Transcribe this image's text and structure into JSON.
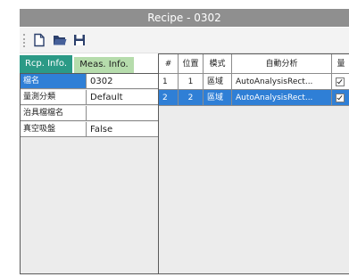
{
  "window": {
    "title": "Recipe - 0302"
  },
  "toolbar": {
    "new_icon": "new-file-icon",
    "open_icon": "open-folder-icon",
    "save_icon": "save-disk-icon"
  },
  "tabs": [
    {
      "label": "Rcp. Info."
    },
    {
      "label": "Meas. Info."
    }
  ],
  "properties": [
    {
      "key": "檔名",
      "value": "0302"
    },
    {
      "key": "量測分類",
      "value": "Default"
    },
    {
      "key": "治具檔檔名",
      "value": ""
    },
    {
      "key": "真空吸盤",
      "value": "False"
    }
  ],
  "grid": {
    "headers": [
      "#",
      "位置",
      "模式",
      "自動分析",
      "量"
    ],
    "rows": [
      {
        "num": "1",
        "pos": "1",
        "mode": "區域",
        "analysis": "AutoAnalysisRect..."
      },
      {
        "num": "2",
        "pos": "2",
        "mode": "區域",
        "analysis": "AutoAnalysisRect..."
      }
    ]
  },
  "colors": {
    "title_bg": "#8f8f8f",
    "tab_active": "#2b9a86",
    "tab_inactive": "#b6dcac",
    "selection": "#2f7fd6"
  }
}
